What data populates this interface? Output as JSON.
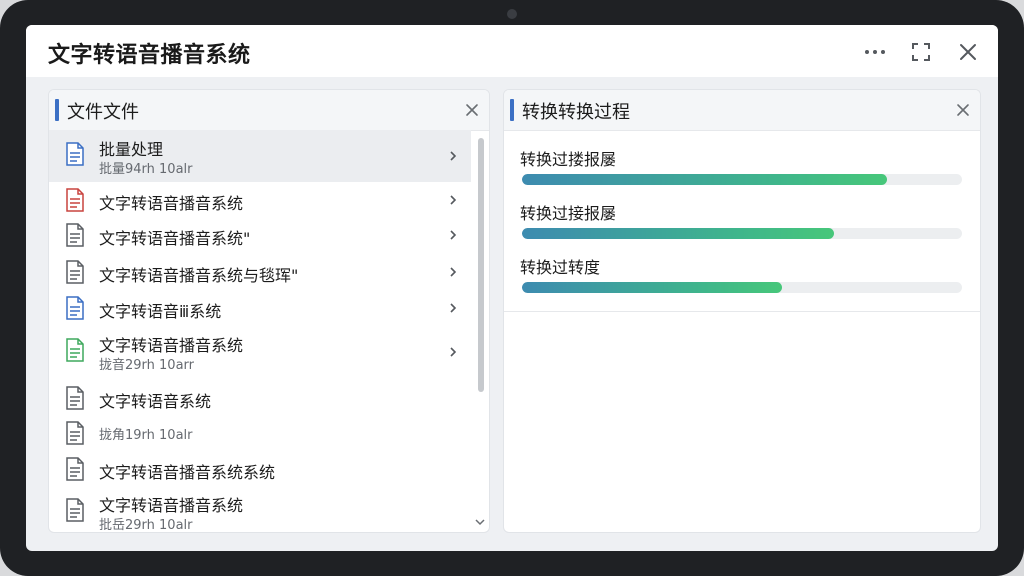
{
  "app": {
    "title": "文字转语音播音系统"
  },
  "left_panel": {
    "title": "文件文件",
    "files": [
      {
        "name": "批量处理",
        "sub": "批量94rh 10alr",
        "icon_color": "#3b6fc4",
        "selected": true
      },
      {
        "name": "文字转语音播音系统",
        "sub": "",
        "icon_color": "#c9433e",
        "selected": false
      },
      {
        "name": "文字转语音播音系统\"",
        "sub": "",
        "icon_color": "#5a5e63",
        "selected": false
      },
      {
        "name": "文字转语音播音系统与毯珲\"",
        "sub": "",
        "icon_color": "#5a5e63",
        "selected": false
      },
      {
        "name": "文字转语音ⅲ系统",
        "sub": "",
        "icon_color": "#3b6fc4",
        "selected": false
      },
      {
        "name": "文字转语音播音系统",
        "sub": "拢音29rh 10arr",
        "icon_color": "#3fa85d",
        "selected": false
      },
      {
        "name": "文字转语音系统",
        "sub": "",
        "icon_color": "#5a5e63",
        "selected": false
      },
      {
        "name": "",
        "sub": "拢角19rh 10alr",
        "icon_color": "#5a5e63",
        "selected": false
      },
      {
        "name": "文字转语音播音系统系统",
        "sub": "",
        "icon_color": "#5a5e63",
        "selected": false
      },
      {
        "name": "文字转语音播音系统",
        "sub": "批岳29rh 10alr",
        "icon_color": "#5a5e63",
        "selected": false
      }
    ]
  },
  "right_panel": {
    "title": "转换转换过程",
    "progress": [
      {
        "label": "转换过搂报屡",
        "value": 0.83
      },
      {
        "label": "转换过接报屡",
        "value": 0.71
      },
      {
        "label": "转换过转度",
        "value": 0.59
      }
    ]
  },
  "icons": {
    "more": "more-horizontal-icon",
    "resize": "resize-icon",
    "close": "close-icon",
    "file": "file-document-icon",
    "chevron": "chevron-right-icon",
    "scroll_down": "chevron-down-icon"
  },
  "colors": {
    "accent": "#3b6fc4",
    "progress_start": "#3d8bb0",
    "progress_end": "#47c77a"
  }
}
